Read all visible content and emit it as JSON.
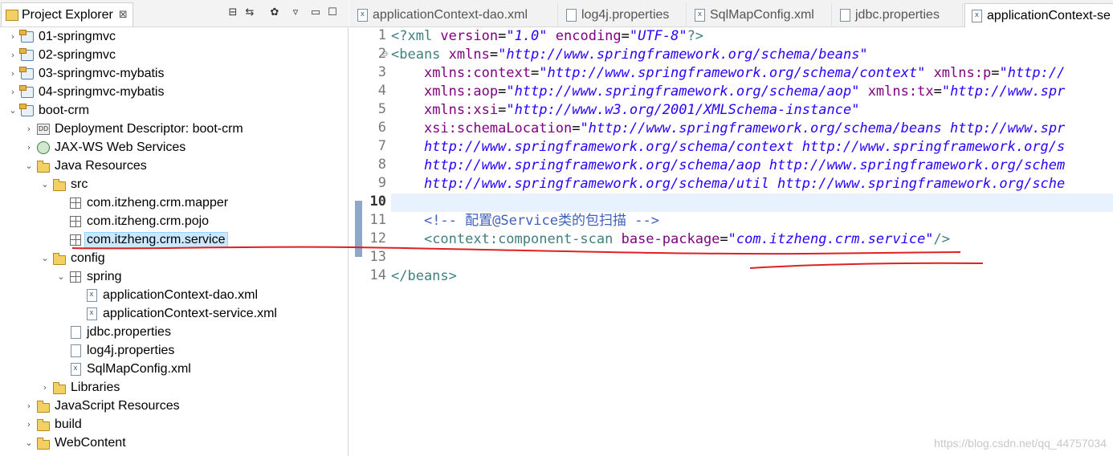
{
  "explorer": {
    "title": "Project Explorer",
    "close_glyph": "⊠",
    "tree": [
      {
        "label": "01-springmvc",
        "depth": 0,
        "twisty": "›",
        "icon": "project-icon"
      },
      {
        "label": "02-springmvc",
        "depth": 0,
        "twisty": "›",
        "icon": "project-icon"
      },
      {
        "label": "03-springmvc-mybatis",
        "depth": 0,
        "twisty": "›",
        "icon": "project-icon"
      },
      {
        "label": "04-springmvc-mybatis",
        "depth": 0,
        "twisty": "›",
        "icon": "project-icon"
      },
      {
        "label": "boot-crm",
        "depth": 0,
        "twisty": "⌄",
        "icon": "project-icon"
      },
      {
        "label": "Deployment Descriptor: boot-crm",
        "depth": 1,
        "twisty": "›",
        "icon": "deployment-descriptor-icon"
      },
      {
        "label": "JAX-WS Web Services",
        "depth": 1,
        "twisty": "›",
        "icon": "jaxws-icon"
      },
      {
        "label": "Java Resources",
        "depth": 1,
        "twisty": "⌄",
        "icon": "java-resources-icon"
      },
      {
        "label": "src",
        "depth": 2,
        "twisty": "⌄",
        "icon": "source-folder-icon"
      },
      {
        "label": "com.itzheng.crm.mapper",
        "depth": 3,
        "twisty": "",
        "icon": "package-icon"
      },
      {
        "label": "com.itzheng.crm.pojo",
        "depth": 3,
        "twisty": "",
        "icon": "package-icon"
      },
      {
        "label": "com.itzheng.crm.service",
        "depth": 3,
        "twisty": "",
        "icon": "package-icon",
        "selected": true
      },
      {
        "label": "config",
        "depth": 2,
        "twisty": "⌄",
        "icon": "source-folder-icon"
      },
      {
        "label": "spring",
        "depth": 3,
        "twisty": "⌄",
        "icon": "package-icon"
      },
      {
        "label": "applicationContext-dao.xml",
        "depth": 4,
        "twisty": "",
        "icon": "xml-file-icon"
      },
      {
        "label": "applicationContext-service.xml",
        "depth": 4,
        "twisty": "",
        "icon": "xml-file-icon"
      },
      {
        "label": "jdbc.properties",
        "depth": 3,
        "twisty": "",
        "icon": "properties-file-icon"
      },
      {
        "label": "log4j.properties",
        "depth": 3,
        "twisty": "",
        "icon": "properties-file-icon"
      },
      {
        "label": "SqlMapConfig.xml",
        "depth": 3,
        "twisty": "",
        "icon": "xml-file-icon"
      },
      {
        "label": "Libraries",
        "depth": 2,
        "twisty": "›",
        "icon": "libraries-icon"
      },
      {
        "label": "JavaScript Resources",
        "depth": 1,
        "twisty": "›",
        "icon": "javascript-resources-icon"
      },
      {
        "label": "build",
        "depth": 1,
        "twisty": "›",
        "icon": "folder-icon"
      },
      {
        "label": "WebContent",
        "depth": 1,
        "twisty": "⌄",
        "icon": "folder-icon"
      }
    ]
  },
  "editor": {
    "tabs": [
      {
        "label": "applicationContext-dao.xml",
        "icon": "xml-file-icon",
        "active": false
      },
      {
        "label": "log4j.properties",
        "icon": "properties-file-icon",
        "active": false
      },
      {
        "label": "SqlMapConfig.xml",
        "icon": "xml-file-icon",
        "active": false
      },
      {
        "label": "jdbc.properties",
        "icon": "properties-file-icon",
        "active": false
      },
      {
        "label": "applicationContext-se",
        "icon": "xml-file-icon",
        "active": true
      }
    ],
    "line_numbers": [
      "1",
      "2",
      "3",
      "4",
      "5",
      "6",
      "7",
      "8",
      "9",
      "10",
      "11",
      "12",
      "13",
      "14"
    ],
    "current_line": "10",
    "lines": [
      [
        {
          "c": "tag",
          "t": "<?xml "
        },
        {
          "c": "attr",
          "t": "version"
        },
        {
          "c": "pun",
          "t": "="
        },
        {
          "c": "val",
          "t": "\"1.0\""
        },
        {
          "c": "pun",
          "t": " "
        },
        {
          "c": "attr",
          "t": "encoding"
        },
        {
          "c": "pun",
          "t": "="
        },
        {
          "c": "val",
          "t": "\"UTF-8\""
        },
        {
          "c": "tag",
          "t": "?>"
        }
      ],
      [
        {
          "c": "tag",
          "t": "<beans "
        },
        {
          "c": "attr",
          "t": "xmlns"
        },
        {
          "c": "pun",
          "t": "="
        },
        {
          "c": "val",
          "t": "\"http://www.springframework.org/schema/beans\""
        }
      ],
      [
        {
          "c": "pun",
          "t": "    "
        },
        {
          "c": "attr",
          "t": "xmlns:context"
        },
        {
          "c": "pun",
          "t": "="
        },
        {
          "c": "val",
          "t": "\"http://www.springframework.org/schema/context\""
        },
        {
          "c": "pun",
          "t": " "
        },
        {
          "c": "attr",
          "t": "xmlns:p"
        },
        {
          "c": "pun",
          "t": "="
        },
        {
          "c": "val",
          "t": "\"http://"
        }
      ],
      [
        {
          "c": "pun",
          "t": "    "
        },
        {
          "c": "attr",
          "t": "xmlns:aop"
        },
        {
          "c": "pun",
          "t": "="
        },
        {
          "c": "val",
          "t": "\"http://www.springframework.org/schema/aop\""
        },
        {
          "c": "pun",
          "t": " "
        },
        {
          "c": "attr",
          "t": "xmlns:tx"
        },
        {
          "c": "pun",
          "t": "="
        },
        {
          "c": "val",
          "t": "\"http://www.spr"
        }
      ],
      [
        {
          "c": "pun",
          "t": "    "
        },
        {
          "c": "attr",
          "t": "xmlns:xsi"
        },
        {
          "c": "pun",
          "t": "="
        },
        {
          "c": "val",
          "t": "\"http://www.w3.org/2001/XMLSchema-instance\""
        }
      ],
      [
        {
          "c": "pun",
          "t": "    "
        },
        {
          "c": "attr",
          "t": "xsi:schemaLocation"
        },
        {
          "c": "pun",
          "t": "="
        },
        {
          "c": "val",
          "t": "\"http://www.springframework.org/schema/beans http://www.spr"
        }
      ],
      [
        {
          "c": "val",
          "t": "    http://www.springframework.org/schema/context http://www.springframework.org/s"
        }
      ],
      [
        {
          "c": "val",
          "t": "    http://www.springframework.org/schema/aop http://www.springframework.org/schem"
        }
      ],
      [
        {
          "c": "val",
          "t": "    http://www.springframework.org/schema/util http://www.springframework.org/sche"
        }
      ],
      [
        {
          "c": "pun",
          "t": ""
        }
      ],
      [
        {
          "c": "pun",
          "t": "    "
        },
        {
          "c": "cmt",
          "t": "<!-- 配置@Service类的包扫描 -->"
        }
      ],
      [
        {
          "c": "pun",
          "t": "    "
        },
        {
          "c": "tag",
          "t": "<context:component-scan "
        },
        {
          "c": "attr",
          "t": "base-package"
        },
        {
          "c": "pun",
          "t": "="
        },
        {
          "c": "val",
          "t": "\"com.itzheng.crm.service\""
        },
        {
          "c": "tag",
          "t": "/>"
        }
      ],
      [
        {
          "c": "pun",
          "t": ""
        }
      ],
      [
        {
          "c": "tag",
          "t": "</beans>"
        }
      ]
    ]
  },
  "watermark": "https://blog.csdn.net/qq_44757034",
  "colors": {
    "tag": "#3f7f7f",
    "attribute": "#7f007f",
    "value": "#2a00ff",
    "comment": "#3f5fbf",
    "annotation": "#e02020",
    "selection": "#cce8ff"
  }
}
